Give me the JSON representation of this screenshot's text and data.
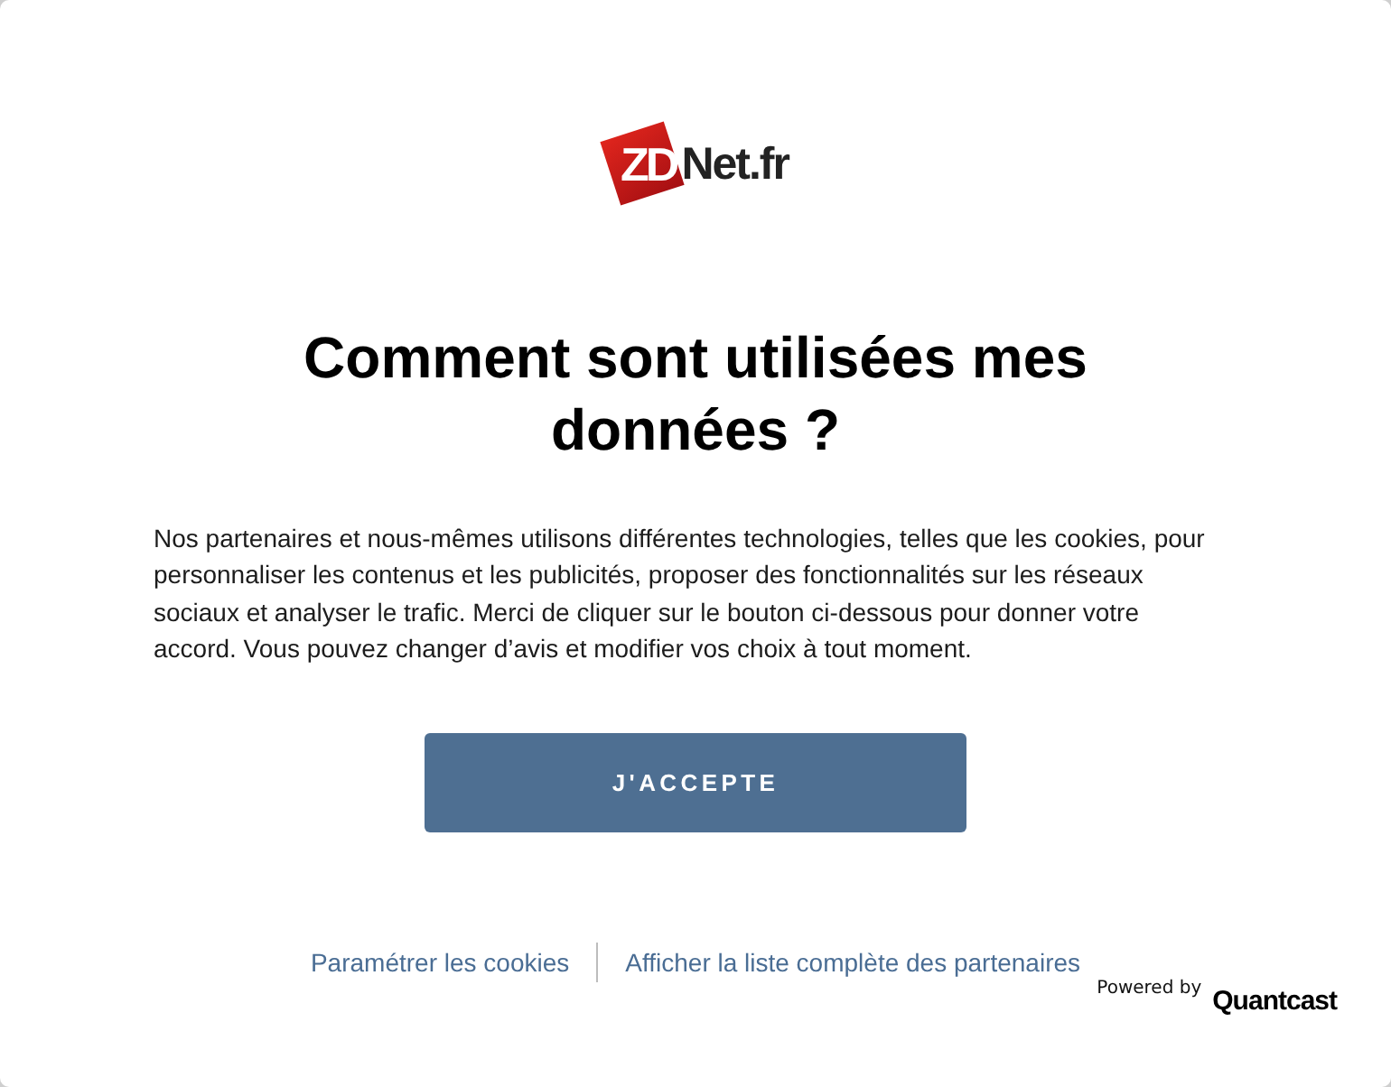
{
  "logo": {
    "mark": "ZD",
    "name": "Net.fr"
  },
  "title": "Comment sont utilisées mes données ?",
  "body": "Nos partenaires et nous-mêmes utilisons différentes technologies, telles que les cookies, pour personnaliser les contenus et les publicités, proposer des fonctionnalités sur les réseaux sociaux et analyser le trafic. Merci de cliquer sur le bouton ci-dessous pour donner votre accord. Vous pouvez changer d’avis et modifier vos choix à tout moment.",
  "accept_button": "J'ACCEPTE",
  "links": [
    "Paramétrer les cookies",
    "Afficher la liste complète des partenaires"
  ],
  "powered_by": {
    "label": "Powered by",
    "brand": "Quantcast"
  }
}
